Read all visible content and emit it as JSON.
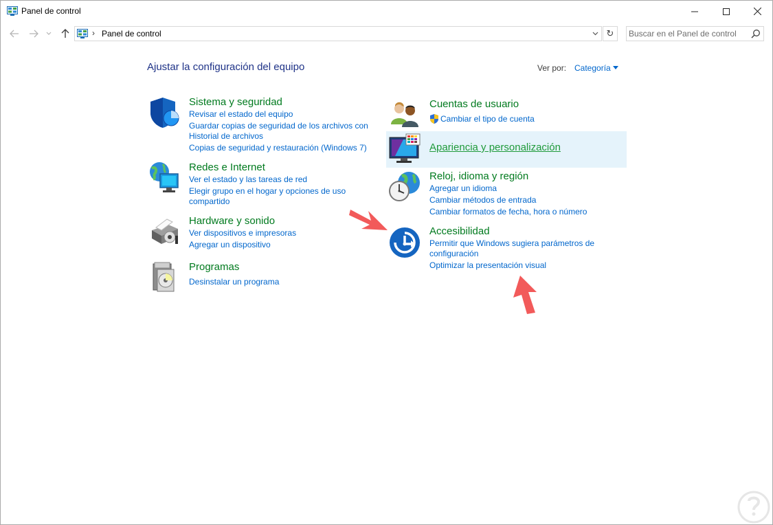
{
  "window": {
    "title": "Panel de control",
    "controls": {
      "minimize": "minimize-icon",
      "maximize": "maximize-icon",
      "close": "close-icon"
    }
  },
  "address": {
    "path": "Panel de control",
    "separator": "›",
    "search_placeholder": "Buscar en el Panel de control"
  },
  "main": {
    "heading": "Ajustar la configuración del equipo",
    "view_by_label": "Ver por:",
    "view_by_value": "Categoría"
  },
  "left_categories": [
    {
      "title": "Sistema y seguridad",
      "icon": "shield-icon",
      "links": [
        "Revisar el estado del equipo",
        "Guardar copias de seguridad de los archivos con",
        "Historial de archivos",
        "Copias de seguridad y restauración (Windows 7)"
      ]
    },
    {
      "title": "Redes e Internet",
      "icon": "network-globe-icon",
      "links": [
        "Ver el estado y las tareas de red",
        "Elegir grupo en el hogar y opciones de uso",
        "compartido"
      ]
    },
    {
      "title": "Hardware y sonido",
      "icon": "printer-icon",
      "links": [
        "Ver dispositivos e impresoras",
        "Agregar un dispositivo"
      ]
    },
    {
      "title": "Programas",
      "icon": "programs-disc-icon",
      "links": [
        "Desinstalar un programa"
      ]
    }
  ],
  "right_categories": [
    {
      "title": "Cuentas de usuario",
      "icon": "user-accounts-icon",
      "links": [
        "Cambiar el tipo de cuenta"
      ]
    },
    {
      "title": "Apariencia y personalización",
      "icon": "monitor-palette-icon",
      "links": []
    },
    {
      "title": "Reloj, idioma y región",
      "icon": "clock-globe-icon",
      "links": [
        "Agregar un idioma",
        "Cambiar métodos de entrada",
        "Cambiar formatos de fecha, hora o número"
      ]
    },
    {
      "title": "Accesibilidad",
      "icon": "accessibility-icon",
      "links": [
        "Permitir que Windows sugiera parámetros de",
        "configuración",
        "Optimizar la presentación visual"
      ]
    }
  ],
  "colors": {
    "title_green": "#007a1e",
    "link_blue": "#0066cc",
    "heading_blue": "#1e3287",
    "hover_bg": "#e5f3fb",
    "annotation_arrow": "#f25a5a"
  }
}
